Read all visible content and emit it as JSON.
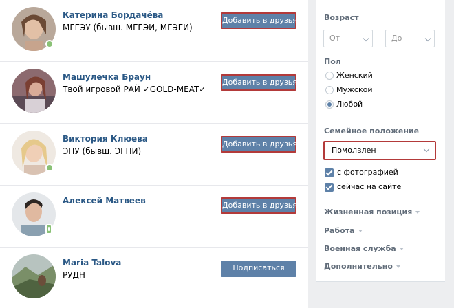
{
  "people": [
    {
      "name": "Катерина Бордачёва",
      "subtitle": "МГГЭУ (бывш. МГГЭИ, МГЭГИ)",
      "action": "Добавить в друзья"
    },
    {
      "name": "Машулечка Браун",
      "subtitle": "Твой игровой РАЙ ✓GOLD-MEAT✓",
      "action": "Добавить в друзья"
    },
    {
      "name": "Виктория Клюева",
      "subtitle": "ЭПУ (бывш. ЭГПИ)",
      "action": "Добавить в друзья"
    },
    {
      "name": "Алексей Матвеев",
      "subtitle": "",
      "action": "Добавить в друзья"
    },
    {
      "name": "Maria Talova",
      "subtitle": "РУДН",
      "action": "Подписаться"
    }
  ],
  "filters": {
    "age": {
      "label": "Возраст",
      "from_placeholder": "От",
      "to_placeholder": "До",
      "separator": "–"
    },
    "sex": {
      "label": "Пол",
      "options": [
        "Женский",
        "Мужской",
        "Любой"
      ],
      "selected": "Любой"
    },
    "marital": {
      "label": "Семейное положение",
      "value": "Помолвлен"
    },
    "checks": [
      "с фотографией",
      "сейчас на сайте"
    ],
    "sections": [
      "Жизненная позиция",
      "Работа",
      "Военная служба",
      "Дополнительно"
    ]
  },
  "colors": {
    "accent": "#5e81a8",
    "link": "#2a5885",
    "online": "#8ac176",
    "highlight": "#b33a3a"
  },
  "icons": [
    "online-dot-icon",
    "online-mobile-icon",
    "chevron-down-icon",
    "checkbox-icon",
    "radio-icon",
    "caret-down-icon"
  ]
}
